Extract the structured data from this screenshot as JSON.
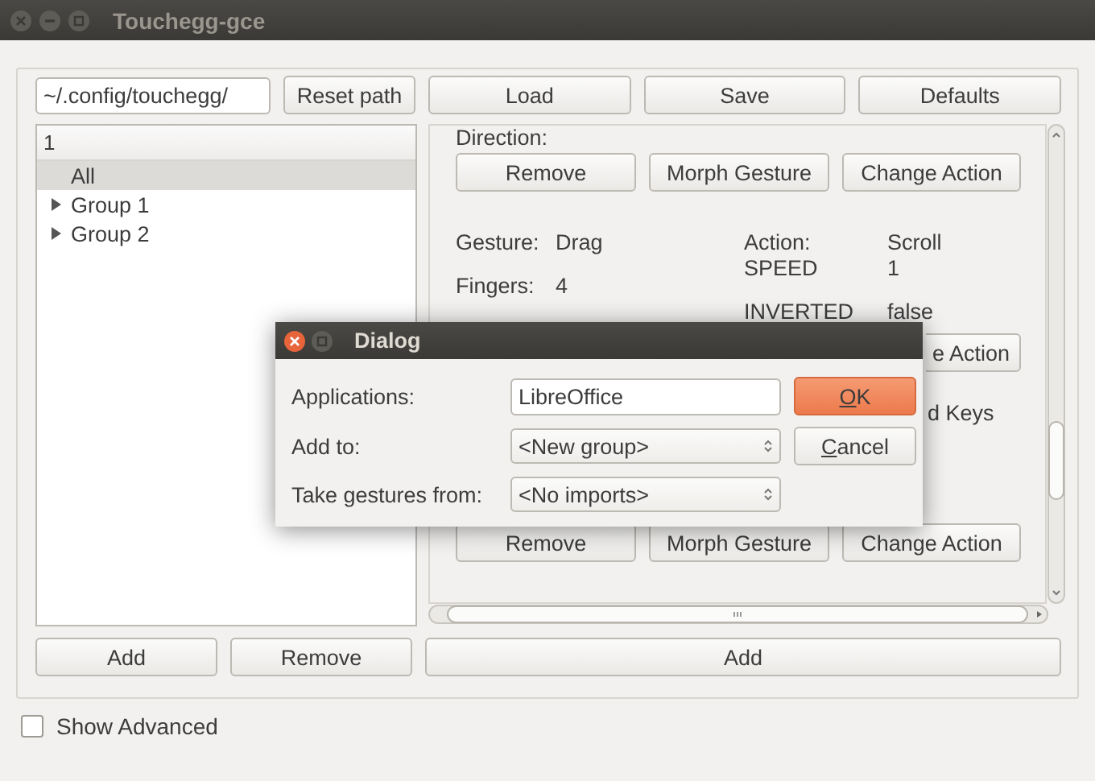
{
  "window": {
    "title": "Touchegg-gce"
  },
  "path_field": {
    "value": "~/.config/touchegg/"
  },
  "toolbar": [
    "Reset path",
    "Load",
    "Save",
    "Defaults"
  ],
  "tree": {
    "header": "1",
    "items": [
      {
        "label": "All",
        "kind": "leaf",
        "selected": true
      },
      {
        "label": "Group 1",
        "kind": "group",
        "selected": false,
        "expanded": false
      },
      {
        "label": "Group 2",
        "kind": "group",
        "selected": false,
        "expanded": false
      }
    ]
  },
  "details": {
    "direction_label": "Direction:",
    "top_buttons": [
      "Remove",
      "Morph Gesture",
      "Change Action"
    ],
    "properties": [
      {
        "label": "Gesture:",
        "value": "Drag",
        "action_label": "Action:",
        "action_value": "Scroll"
      },
      {
        "label": "Fingers:",
        "value": "4",
        "action_label": "SPEED",
        "action_value": "1"
      },
      {
        "action_label": "INVERTED",
        "action_value": "false"
      }
    ],
    "partial_button": "e Action",
    "partial_label": "d Keys",
    "bottom_buttons": [
      "Remove",
      "Morph Gesture",
      "Change Action"
    ]
  },
  "list_buttons": [
    "Add",
    "Remove"
  ],
  "add_button": "Add",
  "show_advanced": {
    "label": "Show Advanced",
    "checked": false
  },
  "dialog": {
    "title": "Dialog",
    "fields": [
      {
        "kind": "text",
        "label": "Applications:",
        "value": "LibreOffice"
      },
      {
        "kind": "combo",
        "label": "Add to:",
        "value": "<New group>"
      },
      {
        "kind": "combo",
        "label": "Take gestures from:",
        "value": "<No imports>"
      }
    ],
    "buttons": [
      {
        "label": "OK",
        "default": true,
        "mnemonic_underlined": true
      },
      {
        "label": "Cancel",
        "default": false,
        "mnemonic_underlined": true
      }
    ]
  }
}
